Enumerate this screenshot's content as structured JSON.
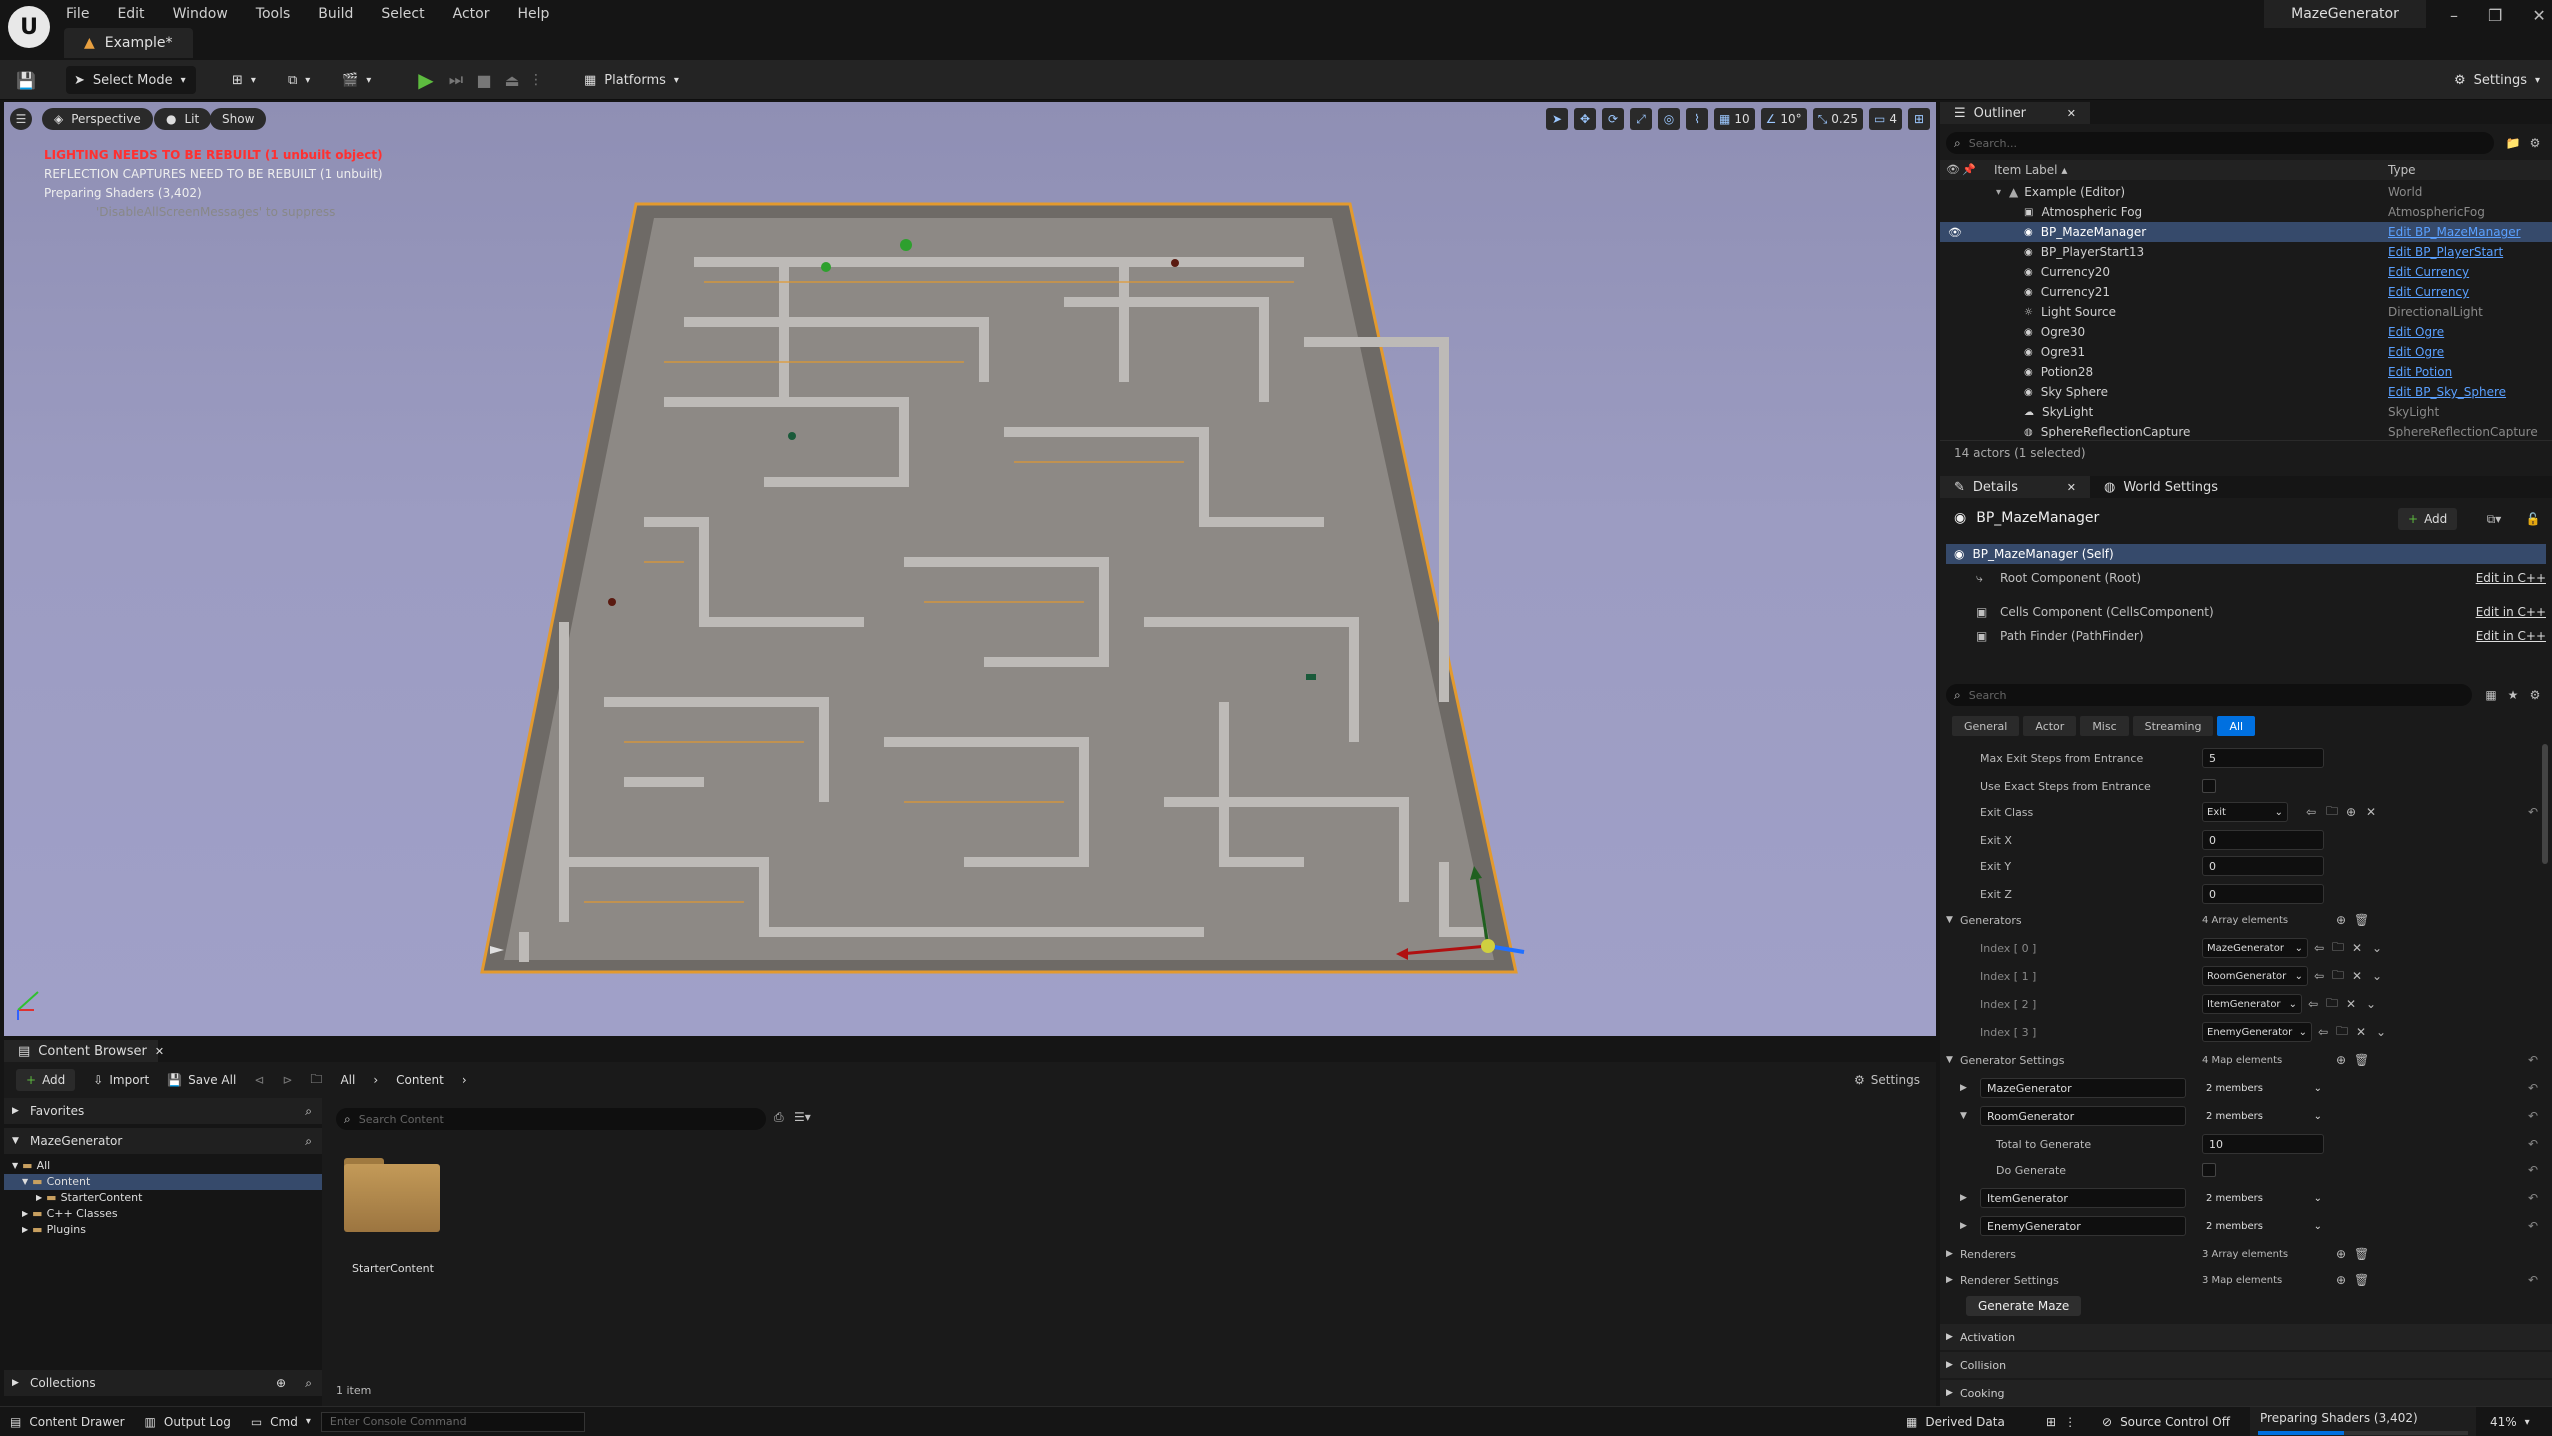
{
  "app": {
    "menus": [
      "File",
      "Edit",
      "Window",
      "Tools",
      "Build",
      "Select",
      "Actor",
      "Help"
    ],
    "document_tab": "Example*",
    "window_title": "MazeGenerator",
    "logo_letter": "U"
  },
  "toolbar": {
    "select_mode": "Select Mode",
    "platforms": "Platforms",
    "settings": "Settings"
  },
  "viewport": {
    "perspective": "Perspective",
    "lit": "Lit",
    "show": "Show",
    "grid_snap": "10",
    "rotation_snap": "10°",
    "scale_snap": "0.25",
    "camera_speed": "4",
    "warnings": [
      "LIGHTING NEEDS TO BE REBUILT (1 unbuilt object)",
      "REFLECTION CAPTURES NEED TO BE REBUILT (1 unbuilt)",
      "Preparing Shaders (3,402)",
      "'DisableAllScreenMessages' to suppress"
    ],
    "warning_color": "#ff3030"
  },
  "outliner": {
    "tab": "Outliner",
    "search_placeholder": "Search...",
    "col_label": "Item Label",
    "col_type": "Type",
    "root": {
      "label": "Example (Editor)",
      "type": "World"
    },
    "items": [
      {
        "label": "Atmospheric Fog",
        "type": "AtmosphericFog",
        "link": false
      },
      {
        "label": "BP_MazeManager",
        "type": "Edit BP_MazeManager",
        "link": true,
        "selected": true
      },
      {
        "label": "BP_PlayerStart13",
        "type": "Edit BP_PlayerStart",
        "link": true
      },
      {
        "label": "Currency20",
        "type": "Edit Currency",
        "link": true
      },
      {
        "label": "Currency21",
        "type": "Edit Currency",
        "link": true
      },
      {
        "label": "Light Source",
        "type": "DirectionalLight",
        "link": false
      },
      {
        "label": "Ogre30",
        "type": "Edit Ogre",
        "link": true
      },
      {
        "label": "Ogre31",
        "type": "Edit Ogre",
        "link": true
      },
      {
        "label": "Potion28",
        "type": "Edit Potion",
        "link": true
      },
      {
        "label": "Sky Sphere",
        "type": "Edit BP_Sky_Sphere",
        "link": true
      },
      {
        "label": "SkyLight",
        "type": "SkyLight",
        "link": false
      },
      {
        "label": "SphereReflectionCapture",
        "type": "SphereReflectionCapture",
        "link": false
      }
    ],
    "footer": "14 actors (1 selected)"
  },
  "details": {
    "tab": "Details",
    "world_settings_tab": "World Settings",
    "actor_name": "BP_MazeManager",
    "add_label": "Add",
    "self_row": "BP_MazeManager (Self)",
    "components": [
      {
        "label": "Root Component (Root)",
        "action": "Edit in C++"
      },
      {
        "label": "Cells Component (CellsComponent)",
        "action": "Edit in C++"
      },
      {
        "label": "Path Finder (PathFinder)",
        "action": "Edit in C++"
      }
    ],
    "search_placeholder": "Search",
    "filter_tabs": [
      "General",
      "Actor",
      "Misc",
      "Streaming",
      "All"
    ],
    "properties": {
      "max_exit_steps_label": "Max Exit Steps from Entrance",
      "max_exit_steps_value": "5",
      "use_exact_steps_label": "Use Exact Steps from Entrance",
      "exit_class_label": "Exit Class",
      "exit_class_value": "Exit",
      "exit_x_label": "Exit X",
      "exit_x_value": "0",
      "exit_y_label": "Exit Y",
      "exit_y_value": "0",
      "exit_z_label": "Exit Z",
      "exit_z_value": "0",
      "generators_label": "Generators",
      "generators_count": "4 Array elements",
      "generators": [
        {
          "index": "Index [ 0 ]",
          "value": "MazeGenerator"
        },
        {
          "index": "Index [ 1 ]",
          "value": "RoomGenerator"
        },
        {
          "index": "Index [ 2 ]",
          "value": "ItemGenerator"
        },
        {
          "index": "Index [ 3 ]",
          "value": "EnemyGenerator"
        }
      ],
      "generator_settings_label": "Generator Settings",
      "generator_settings_count": "4 Map elements",
      "gs_maze": "MazeGenerator",
      "gs_maze_members": "2 members",
      "gs_room": "RoomGenerator",
      "gs_room_members": "2 members",
      "total_label": "Total to Generate",
      "total_value": "10",
      "do_generate_label": "Do Generate",
      "gs_item": "ItemGenerator",
      "gs_item_members": "2 members",
      "gs_enemy": "EnemyGenerator",
      "gs_enemy_members": "2 members",
      "renderers_label": "Renderers",
      "renderers_count": "3 Array elements",
      "renderer_settings_label": "Renderer Settings",
      "renderer_settings_count": "3 Map elements",
      "generate_button": "Generate Maze",
      "activation": "Activation",
      "collision": "Collision",
      "cooking": "Cooking"
    }
  },
  "content_browser": {
    "tab": "Content Browser",
    "add": "Add",
    "import": "Import",
    "save_all": "Save All",
    "crumb_all": "All",
    "crumb_content": "Content",
    "settings": "Settings",
    "favorites": "Favorites",
    "project": "MazeGenerator",
    "tree": [
      "All",
      "Content",
      "StarterContent",
      "C++ Classes",
      "Plugins"
    ],
    "search_placeholder": "Search Content",
    "folder_name": "StarterContent",
    "item_count": "1 item",
    "collections": "Collections"
  },
  "statusbar": {
    "content_drawer": "Content Drawer",
    "output_log": "Output Log",
    "cmd": "Cmd",
    "console_placeholder": "Enter Console Command",
    "derived_data": "Derived Data",
    "source_control": "Source Control Off",
    "progress_text": "Preparing Shaders (3,402)",
    "progress_percent": "41%"
  },
  "colors": {
    "accent_blue": "#0070e0",
    "selection": "#364a6b",
    "wall_outline": "#e39a2e",
    "play_green": "#5dbb3f"
  }
}
